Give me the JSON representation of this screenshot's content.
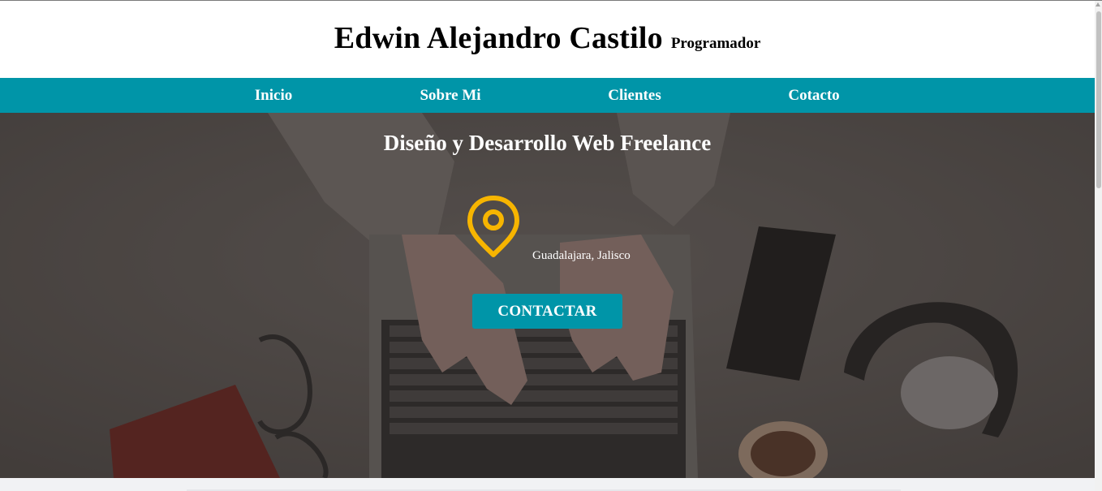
{
  "header": {
    "name": "Edwin Alejandro Castilo",
    "role": "Programador"
  },
  "nav": {
    "items": [
      {
        "label": "Inicio"
      },
      {
        "label": "Sobre Mi"
      },
      {
        "label": "Clientes"
      },
      {
        "label": "Cotacto"
      }
    ]
  },
  "hero": {
    "title": "Diseño y Desarrollo Web Freelance",
    "location_icon": "map-pin-icon",
    "location": "Guadalajara, Jalisco",
    "cta_label": "CONTACTAR"
  },
  "colors": {
    "accent": "#0095a8",
    "pin": "#f7b500",
    "hero_overlay": "#5d5755"
  }
}
